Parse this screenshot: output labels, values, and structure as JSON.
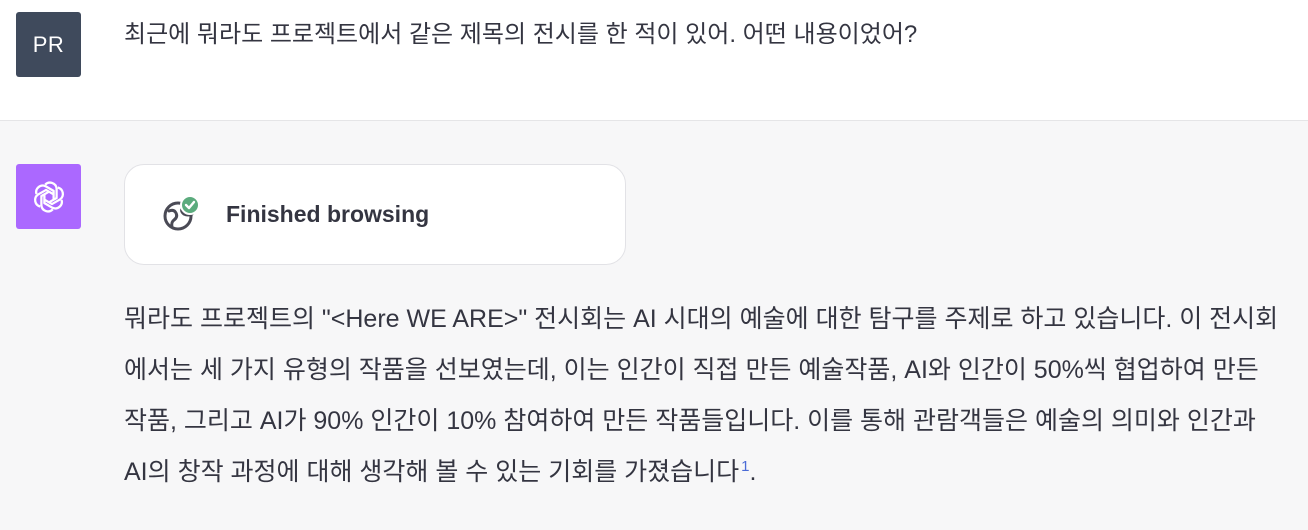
{
  "user": {
    "avatar_initials": "PR",
    "message": "최근에 뭐라도 프로젝트에서 같은 제목의 전시를 한 적이 있어. 어떤 내용이었어?"
  },
  "assistant": {
    "avatar_icon": "openai-logo-icon",
    "avatar_color": "#ab68ff",
    "browsing_status": "Finished browsing",
    "browsing_icon": "globe-check-icon",
    "answer_text": "뭐라도 프로젝트의 \"<Here WE ARE>\" 전시회는 AI 시대의 예술에 대한 탐구를 주제로 하고 있습니다. 이 전시회에서는 세 가지 유형의 작품을 선보였는데, 이는 인간이 직접 만든 예술작품, AI와 인간이 50%씩 협업하여 만든 작품, 그리고 AI가 90% 인간이 10% 참여하여 만든 작품들입니다. 이를 통해 관람객들은 예술의 의미와 인간과 AI의 창작 과정에 대해 생각해 볼 수 있는 기회를 가졌습니다",
    "citation": "1",
    "answer_end": "."
  },
  "colors": {
    "user_avatar": "#3f4a5c",
    "assistant_bg": "#f7f7f8",
    "check_badge": "#5bab7d"
  }
}
